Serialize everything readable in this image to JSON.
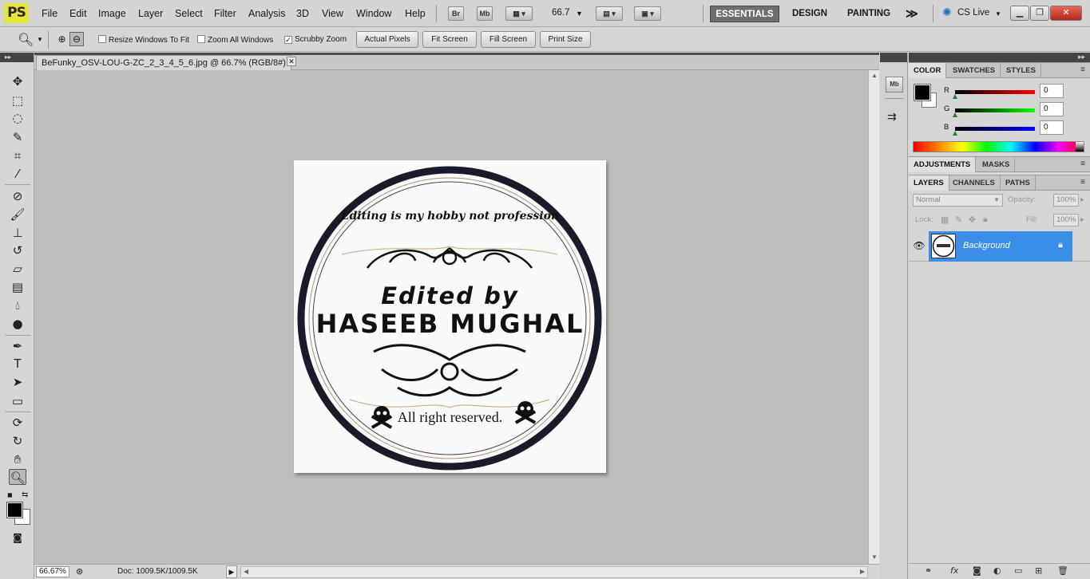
{
  "app": {
    "logo": "PS"
  },
  "menu": [
    "File",
    "Edit",
    "Image",
    "Layer",
    "Select",
    "Filter",
    "Analysis",
    "3D",
    "View",
    "Window",
    "Help"
  ],
  "menubar_buttons": {
    "bridge": "Br",
    "mini_bridge": "Mb",
    "zoom_level": "66.7"
  },
  "workspaces": {
    "essentials": "ESSENTIALS",
    "design": "DESIGN",
    "painting": "PAINTING",
    "more": "≫"
  },
  "cs_live": "CS Live",
  "options": {
    "resize_windows": {
      "label": "Resize Windows To Fit",
      "checked": false
    },
    "zoom_all": {
      "label": "Zoom All Windows",
      "checked": false
    },
    "scrubby_zoom": {
      "label": "Scrubby Zoom",
      "checked": true
    },
    "buttons": [
      "Actual Pixels",
      "Fit Screen",
      "Fill Screen",
      "Print Size"
    ]
  },
  "document_tab": {
    "title": "BeFunky_OSV-LOU-G-ZC_2_3_4_5_6.jpg @ 66.7% (RGB/8#)",
    "close": "✕"
  },
  "status": {
    "zoom": "66.67%",
    "doc": "Doc: 1009.5K/1009.5K"
  },
  "color_panel": {
    "tabs": [
      "COLOR",
      "SWATCHES",
      "STYLES"
    ],
    "r": {
      "label": "R",
      "value": "0"
    },
    "g": {
      "label": "G",
      "value": "0"
    },
    "b": {
      "label": "B",
      "value": "0"
    }
  },
  "adjustments_panel": {
    "tabs": [
      "ADJUSTMENTS",
      "MASKS"
    ]
  },
  "layers_panel": {
    "tabs": [
      "LAYERS",
      "CHANNELS",
      "PATHS"
    ],
    "blend_mode": "Normal",
    "opacity_label": "Opacity:",
    "opacity": "100%",
    "lock_label": "Lock:",
    "fill_label": "Fill:",
    "fill": "100%",
    "layer_name": "Background"
  },
  "stamp": {
    "top_text": "Editing is my hobby not profession",
    "edited_by": "Edited by",
    "name": "HASEEB MUGHAL",
    "bottom_text": "All right reserved."
  },
  "colors": {
    "accent_selection": "#3b8ee8",
    "canvas_bg": "#bdbdbd",
    "logo_yellow": "#e6e63a"
  }
}
